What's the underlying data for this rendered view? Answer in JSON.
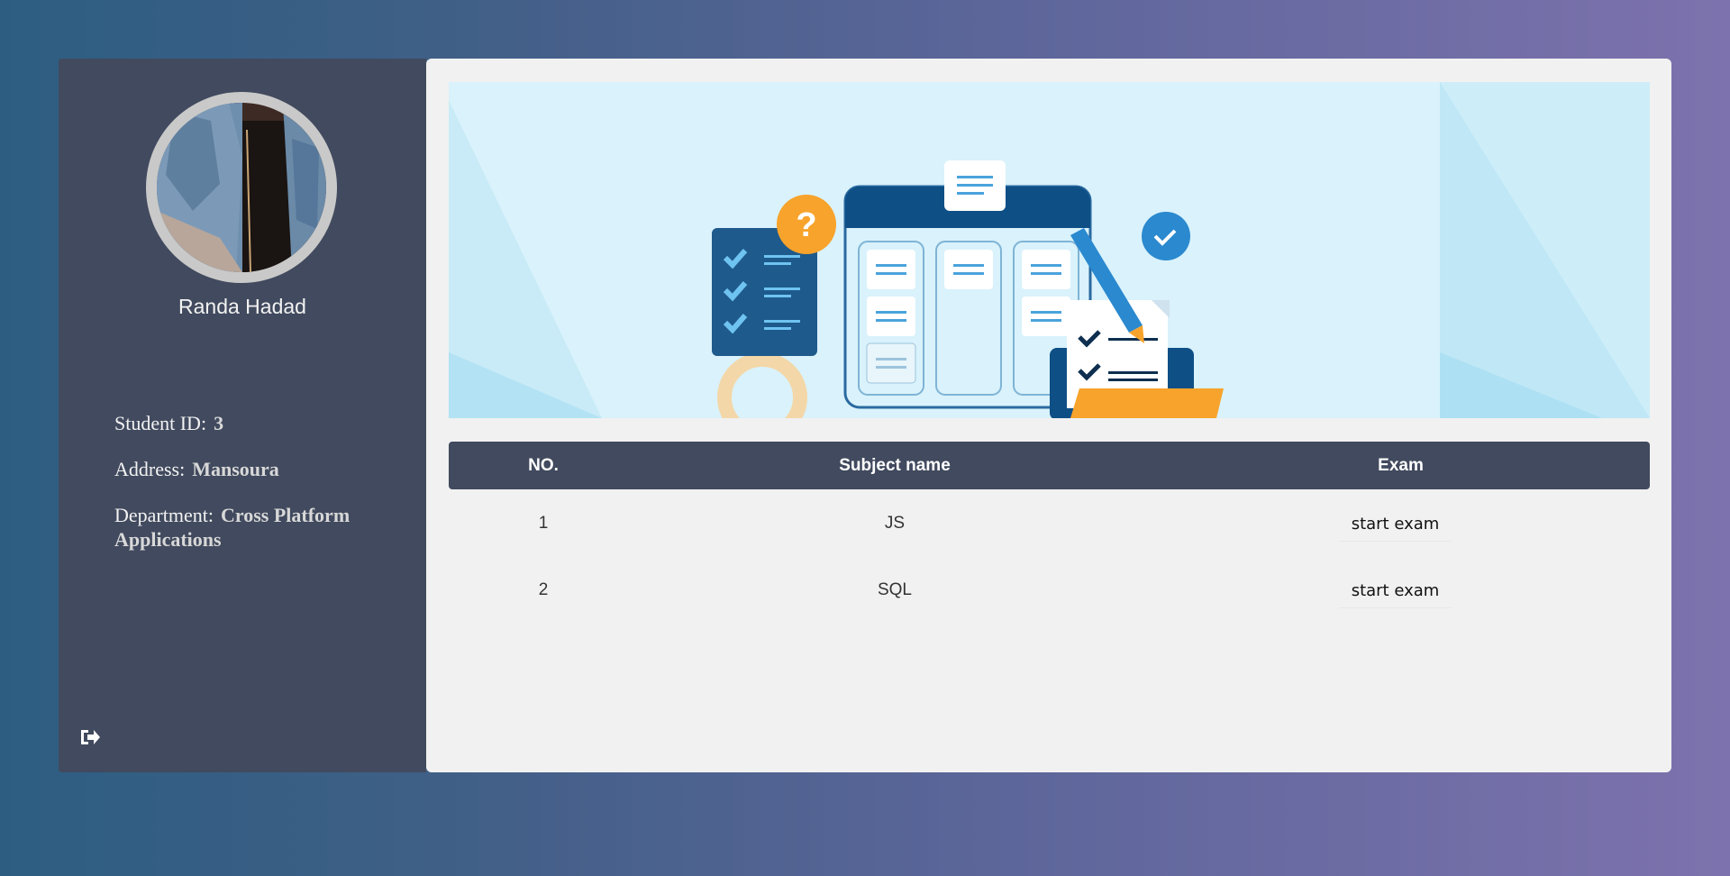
{
  "profile": {
    "name": "Randa Hadad",
    "student_id_label": "Student ID:",
    "student_id": "3",
    "address_label": "Address:",
    "address": "Mansoura",
    "department_label": "Department:",
    "department": "Cross Platform Applications"
  },
  "sidebar": {
    "logout_icon": "sign-out-icon"
  },
  "table": {
    "headers": [
      "NO.",
      "Subject name",
      "Exam"
    ],
    "rows": [
      {
        "no": "1",
        "subject": "JS",
        "action": "start exam"
      },
      {
        "no": "2",
        "subject": "SQL",
        "action": "start exam"
      }
    ]
  },
  "colors": {
    "sidebar_bg": "#414a5e",
    "main_bg": "#f1f1f1",
    "banner_bg": "#d9f2fb",
    "accent_orange": "#f7a32c",
    "accent_blue": "#2a89cf"
  }
}
